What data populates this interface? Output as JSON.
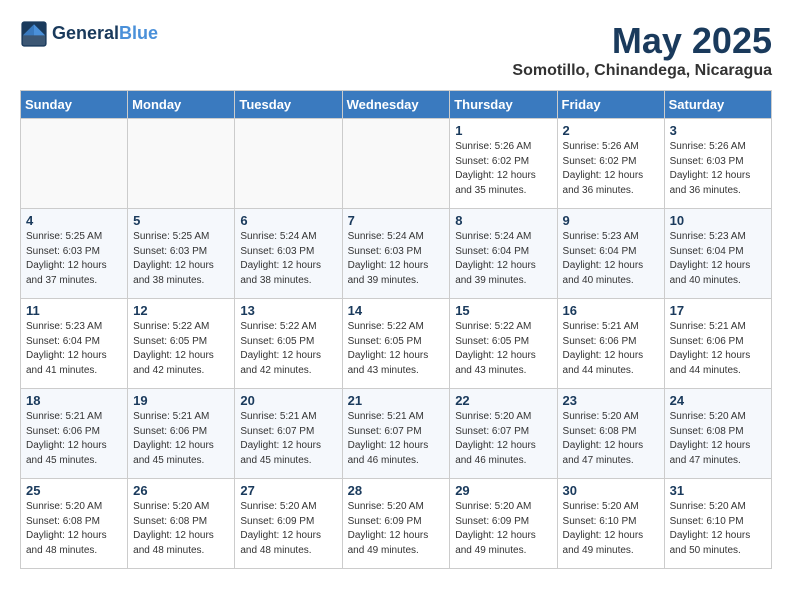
{
  "header": {
    "logo_line1": "General",
    "logo_line2": "Blue",
    "title": "May 2025",
    "subtitle": "Somotillo, Chinandega, Nicaragua"
  },
  "weekdays": [
    "Sunday",
    "Monday",
    "Tuesday",
    "Wednesday",
    "Thursday",
    "Friday",
    "Saturday"
  ],
  "weeks": [
    [
      {
        "day": "",
        "info": ""
      },
      {
        "day": "",
        "info": ""
      },
      {
        "day": "",
        "info": ""
      },
      {
        "day": "",
        "info": ""
      },
      {
        "day": "1",
        "info": "Sunrise: 5:26 AM\nSunset: 6:02 PM\nDaylight: 12 hours\nand 35 minutes."
      },
      {
        "day": "2",
        "info": "Sunrise: 5:26 AM\nSunset: 6:02 PM\nDaylight: 12 hours\nand 36 minutes."
      },
      {
        "day": "3",
        "info": "Sunrise: 5:26 AM\nSunset: 6:03 PM\nDaylight: 12 hours\nand 36 minutes."
      }
    ],
    [
      {
        "day": "4",
        "info": "Sunrise: 5:25 AM\nSunset: 6:03 PM\nDaylight: 12 hours\nand 37 minutes."
      },
      {
        "day": "5",
        "info": "Sunrise: 5:25 AM\nSunset: 6:03 PM\nDaylight: 12 hours\nand 38 minutes."
      },
      {
        "day": "6",
        "info": "Sunrise: 5:24 AM\nSunset: 6:03 PM\nDaylight: 12 hours\nand 38 minutes."
      },
      {
        "day": "7",
        "info": "Sunrise: 5:24 AM\nSunset: 6:03 PM\nDaylight: 12 hours\nand 39 minutes."
      },
      {
        "day": "8",
        "info": "Sunrise: 5:24 AM\nSunset: 6:04 PM\nDaylight: 12 hours\nand 39 minutes."
      },
      {
        "day": "9",
        "info": "Sunrise: 5:23 AM\nSunset: 6:04 PM\nDaylight: 12 hours\nand 40 minutes."
      },
      {
        "day": "10",
        "info": "Sunrise: 5:23 AM\nSunset: 6:04 PM\nDaylight: 12 hours\nand 40 minutes."
      }
    ],
    [
      {
        "day": "11",
        "info": "Sunrise: 5:23 AM\nSunset: 6:04 PM\nDaylight: 12 hours\nand 41 minutes."
      },
      {
        "day": "12",
        "info": "Sunrise: 5:22 AM\nSunset: 6:05 PM\nDaylight: 12 hours\nand 42 minutes."
      },
      {
        "day": "13",
        "info": "Sunrise: 5:22 AM\nSunset: 6:05 PM\nDaylight: 12 hours\nand 42 minutes."
      },
      {
        "day": "14",
        "info": "Sunrise: 5:22 AM\nSunset: 6:05 PM\nDaylight: 12 hours\nand 43 minutes."
      },
      {
        "day": "15",
        "info": "Sunrise: 5:22 AM\nSunset: 6:05 PM\nDaylight: 12 hours\nand 43 minutes."
      },
      {
        "day": "16",
        "info": "Sunrise: 5:21 AM\nSunset: 6:06 PM\nDaylight: 12 hours\nand 44 minutes."
      },
      {
        "day": "17",
        "info": "Sunrise: 5:21 AM\nSunset: 6:06 PM\nDaylight: 12 hours\nand 44 minutes."
      }
    ],
    [
      {
        "day": "18",
        "info": "Sunrise: 5:21 AM\nSunset: 6:06 PM\nDaylight: 12 hours\nand 45 minutes."
      },
      {
        "day": "19",
        "info": "Sunrise: 5:21 AM\nSunset: 6:06 PM\nDaylight: 12 hours\nand 45 minutes."
      },
      {
        "day": "20",
        "info": "Sunrise: 5:21 AM\nSunset: 6:07 PM\nDaylight: 12 hours\nand 45 minutes."
      },
      {
        "day": "21",
        "info": "Sunrise: 5:21 AM\nSunset: 6:07 PM\nDaylight: 12 hours\nand 46 minutes."
      },
      {
        "day": "22",
        "info": "Sunrise: 5:20 AM\nSunset: 6:07 PM\nDaylight: 12 hours\nand 46 minutes."
      },
      {
        "day": "23",
        "info": "Sunrise: 5:20 AM\nSunset: 6:08 PM\nDaylight: 12 hours\nand 47 minutes."
      },
      {
        "day": "24",
        "info": "Sunrise: 5:20 AM\nSunset: 6:08 PM\nDaylight: 12 hours\nand 47 minutes."
      }
    ],
    [
      {
        "day": "25",
        "info": "Sunrise: 5:20 AM\nSunset: 6:08 PM\nDaylight: 12 hours\nand 48 minutes."
      },
      {
        "day": "26",
        "info": "Sunrise: 5:20 AM\nSunset: 6:08 PM\nDaylight: 12 hours\nand 48 minutes."
      },
      {
        "day": "27",
        "info": "Sunrise: 5:20 AM\nSunset: 6:09 PM\nDaylight: 12 hours\nand 48 minutes."
      },
      {
        "day": "28",
        "info": "Sunrise: 5:20 AM\nSunset: 6:09 PM\nDaylight: 12 hours\nand 49 minutes."
      },
      {
        "day": "29",
        "info": "Sunrise: 5:20 AM\nSunset: 6:09 PM\nDaylight: 12 hours\nand 49 minutes."
      },
      {
        "day": "30",
        "info": "Sunrise: 5:20 AM\nSunset: 6:10 PM\nDaylight: 12 hours\nand 49 minutes."
      },
      {
        "day": "31",
        "info": "Sunrise: 5:20 AM\nSunset: 6:10 PM\nDaylight: 12 hours\nand 50 minutes."
      }
    ]
  ]
}
